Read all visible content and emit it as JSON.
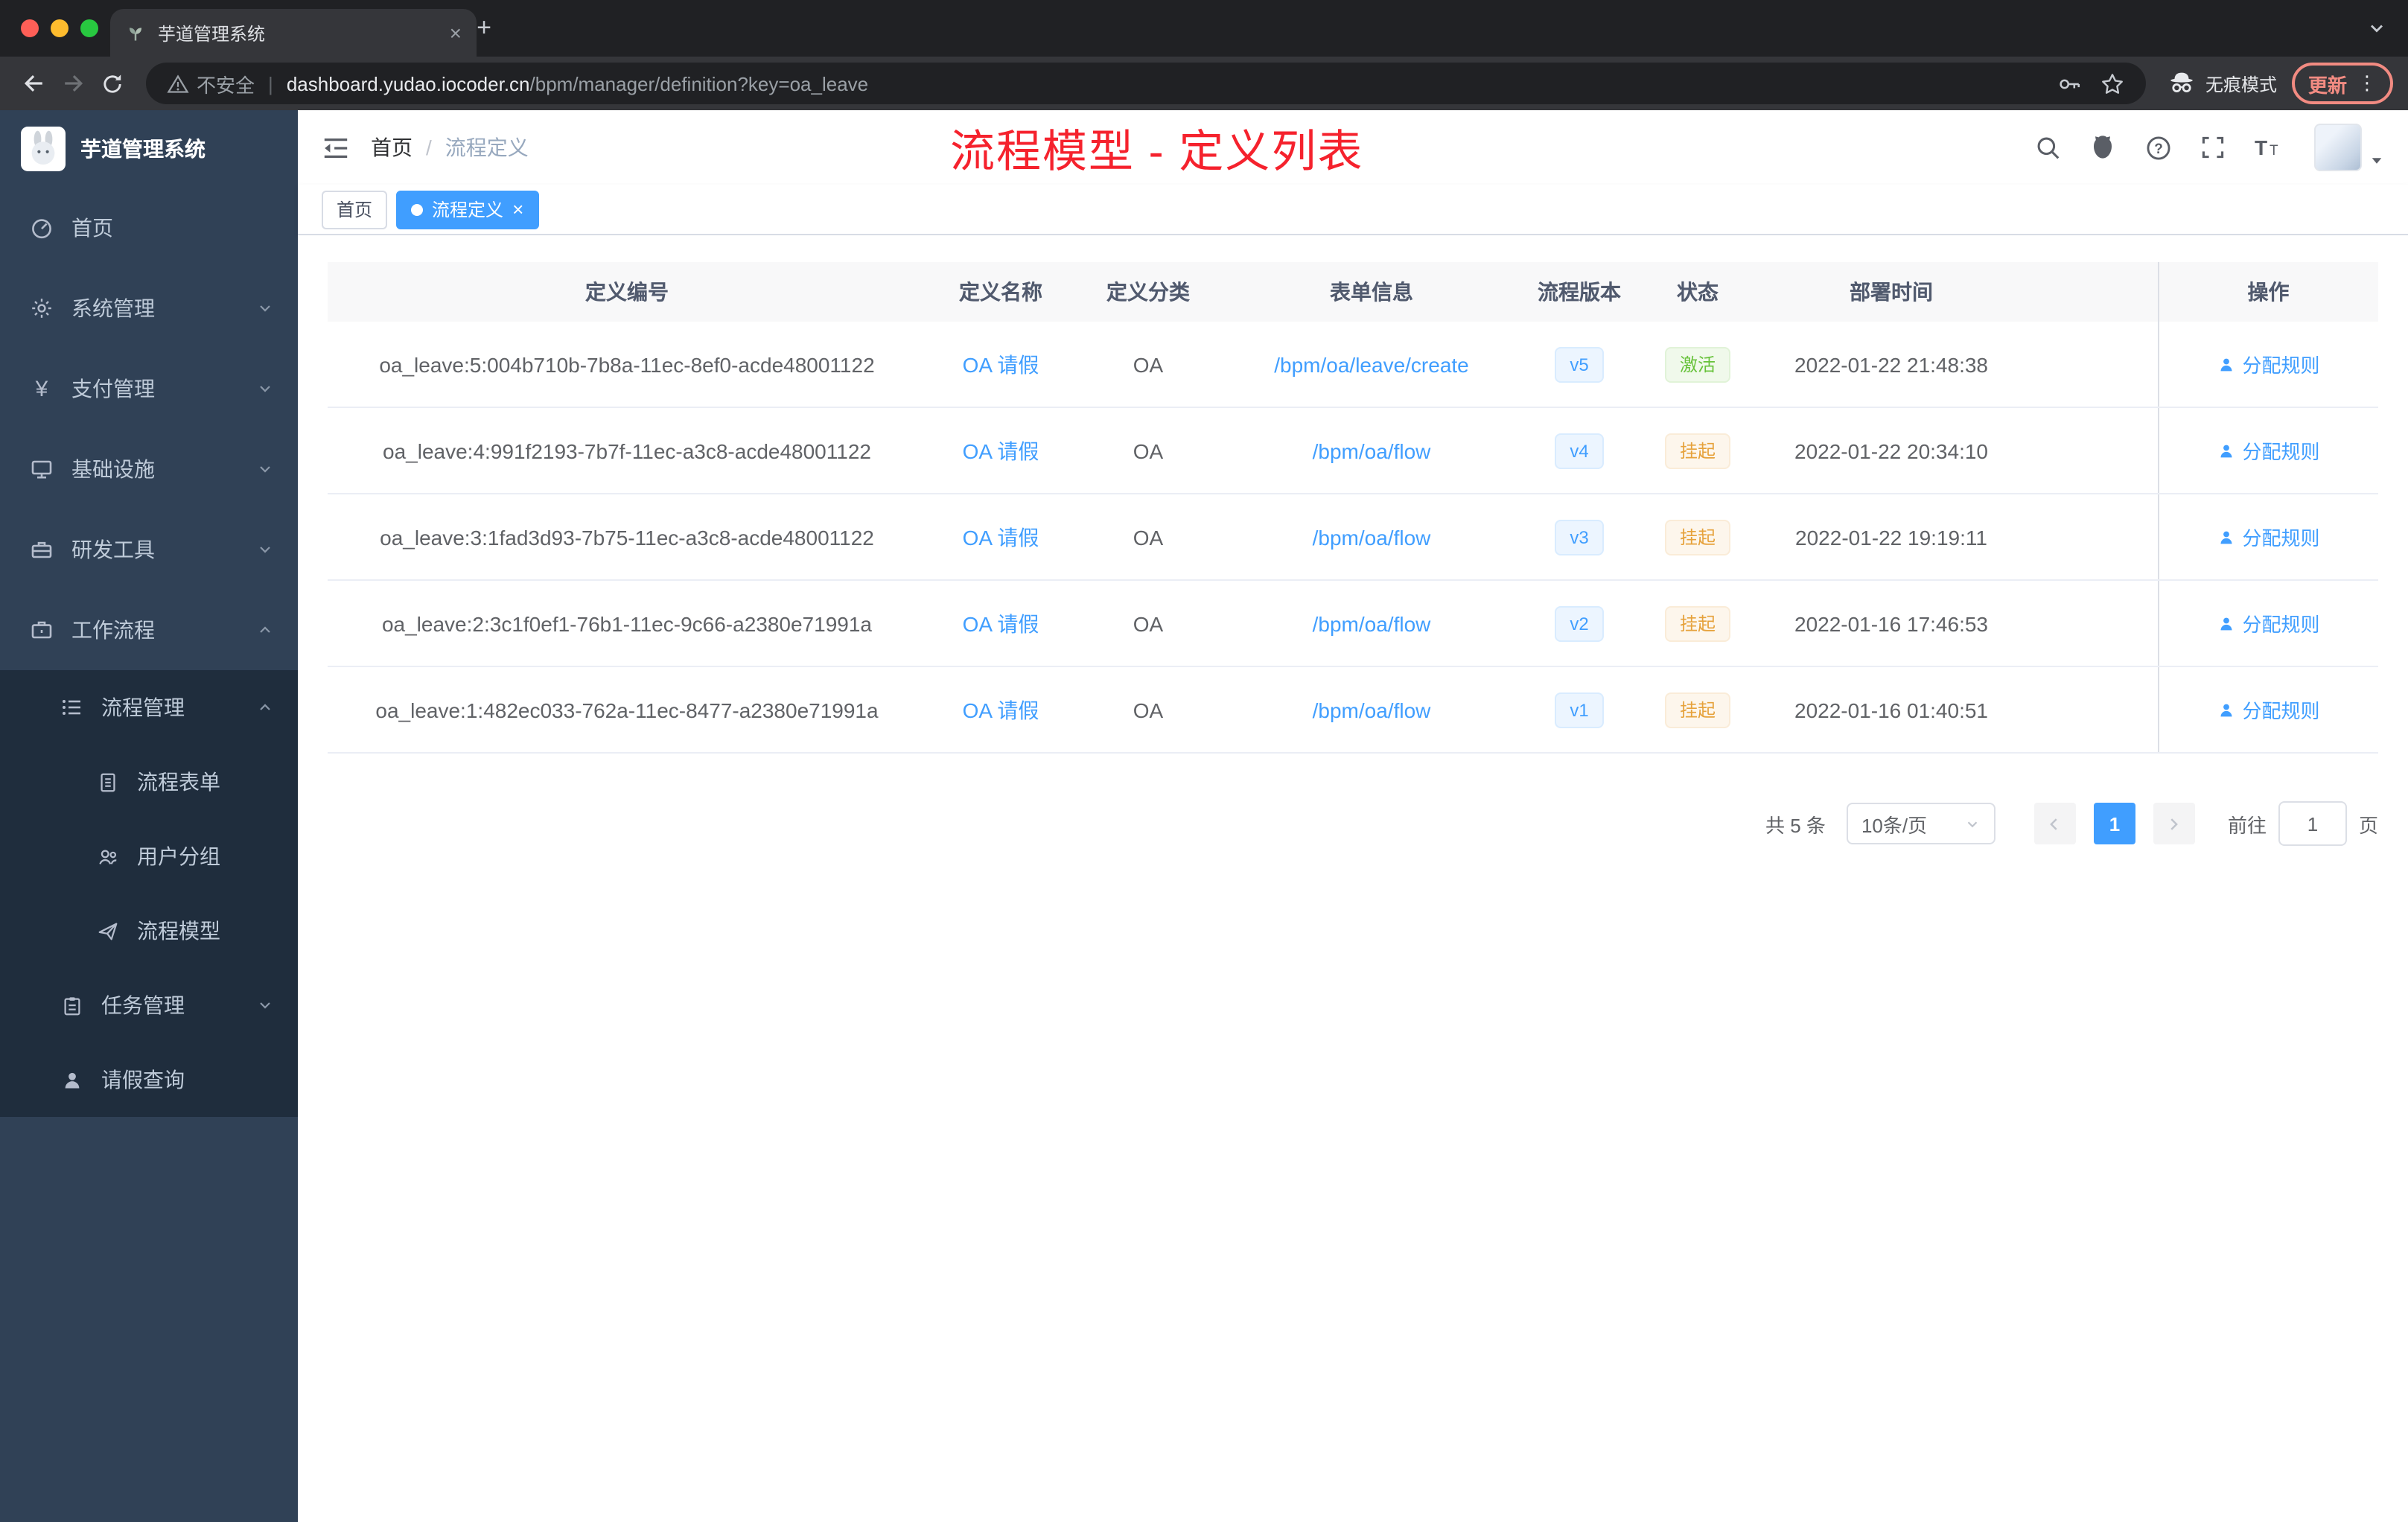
{
  "colors": {
    "accent": "#409eff",
    "success": "#67c23a",
    "warning": "#e6a23c",
    "annotation_red": "#f5222d",
    "sidebar_bg": "#304156",
    "submenu_bg": "#1f2d3d"
  },
  "browser": {
    "tab_title": "芋道管理系统",
    "security_label": "不安全",
    "url_host": "dashboard.yudao.iocoder.cn",
    "url_path": "/bpm/manager/definition?key=oa_leave",
    "incognito_label": "无痕模式",
    "update_label": "更新"
  },
  "sidebar": {
    "logo_title": "芋道管理系统",
    "items": [
      {
        "label": "首页"
      },
      {
        "label": "系统管理"
      },
      {
        "label": "支付管理"
      },
      {
        "label": "基础设施"
      },
      {
        "label": "研发工具"
      },
      {
        "label": "工作流程"
      },
      {
        "label": "流程管理"
      },
      {
        "label": "流程表单"
      },
      {
        "label": "用户分组"
      },
      {
        "label": "流程模型"
      },
      {
        "label": "任务管理"
      },
      {
        "label": "请假查询"
      }
    ]
  },
  "header": {
    "breadcrumb_home": "首页",
    "breadcrumb_separator": "/",
    "breadcrumb_current": "流程定义",
    "annotation": "流程模型 - 定义列表"
  },
  "tags": {
    "home": "首页",
    "active": "流程定义"
  },
  "table": {
    "columns": [
      "定义编号",
      "定义名称",
      "定义分类",
      "表单信息",
      "流程版本",
      "状态",
      "部署时间",
      "操作"
    ],
    "rows": [
      {
        "id": "oa_leave:5:004b710b-7b8a-11ec-8ef0-acde48001122",
        "name": "OA 请假",
        "category": "OA",
        "form": "/bpm/oa/leave/create",
        "version": "v5",
        "status": "激活",
        "time": "2022-01-22 21:48:38",
        "action": "分配规则"
      },
      {
        "id": "oa_leave:4:991f2193-7b7f-11ec-a3c8-acde48001122",
        "name": "OA 请假",
        "category": "OA",
        "form": "/bpm/oa/flow",
        "version": "v4",
        "status": "挂起",
        "time": "2022-01-22 20:34:10",
        "action": "分配规则"
      },
      {
        "id": "oa_leave:3:1fad3d93-7b75-11ec-a3c8-acde48001122",
        "name": "OA 请假",
        "category": "OA",
        "form": "/bpm/oa/flow",
        "version": "v3",
        "status": "挂起",
        "time": "2022-01-22 19:19:11",
        "action": "分配规则"
      },
      {
        "id": "oa_leave:2:3c1f0ef1-76b1-11ec-9c66-a2380e71991a",
        "name": "OA 请假",
        "category": "OA",
        "form": "/bpm/oa/flow",
        "version": "v2",
        "status": "挂起",
        "time": "2022-01-16 17:46:53",
        "action": "分配规则"
      },
      {
        "id": "oa_leave:1:482ec033-762a-11ec-8477-a2380e71991a",
        "name": "OA 请假",
        "category": "OA",
        "form": "/bpm/oa/flow",
        "version": "v1",
        "status": "挂起",
        "time": "2022-01-16 01:40:51",
        "action": "分配规则"
      }
    ]
  },
  "pagination": {
    "total": "共 5 条",
    "page_size": "10条/页",
    "page": "1",
    "goto_label": "前往",
    "goto_value": "1",
    "unit_label": "页"
  }
}
